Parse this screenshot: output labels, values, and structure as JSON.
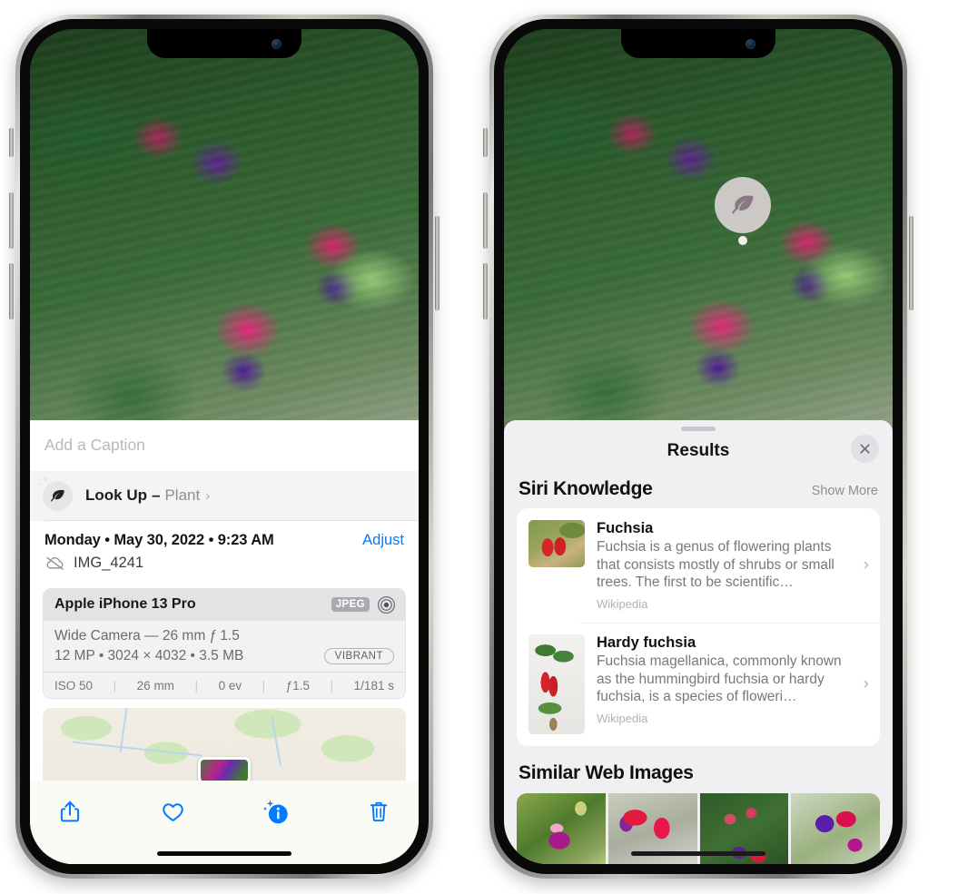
{
  "left_phone": {
    "photo": {
      "alt": "fuchsia-plant-photo",
      "name": "photo-fuchsia-hanging-basket"
    },
    "caption": {
      "placeholder": "Add a Caption",
      "value": ""
    },
    "look_up": {
      "icon": "leaf-icon",
      "label": "Look Up",
      "dash": "–",
      "subject": "Plant",
      "chevron": "›"
    },
    "meta": {
      "date": "Monday • May 30, 2022 • 9:23 AM",
      "adjust_label": "Adjust",
      "cloud_icon": "cloud-slash-icon",
      "filename": "IMG_4241"
    },
    "exif": {
      "device": "Apple iPhone 13 Pro",
      "format_chip": "JPEG",
      "aperture_icon": "aperture-icon",
      "lens_line": "Wide Camera — 26 mm ƒ 1.5",
      "dims_line": "12 MP • 3024 × 4032 • 3.5 MB",
      "style_chip": "VIBRANT",
      "stats": [
        "ISO 50",
        "26 mm",
        "0 ev",
        "ƒ1.5",
        "1/181 s"
      ],
      "separator": "|"
    },
    "map": {
      "name": "location-map-thumbnail",
      "pin": "photo-location-pin"
    },
    "toolbar": [
      {
        "name": "share-button",
        "icon": "share-icon"
      },
      {
        "name": "favorite-button",
        "icon": "heart-icon"
      },
      {
        "name": "info-button",
        "icon": "info-sparkle-icon"
      },
      {
        "name": "delete-button",
        "icon": "trash-icon"
      }
    ],
    "accent_color": "#047aff",
    "home_indicator": "home-indicator"
  },
  "right_phone": {
    "photo": {
      "alt": "fuchsia-plant-photo",
      "name": "photo-fuchsia-hanging-basket"
    },
    "visual_look_up_pin": {
      "icon": "leaf-icon",
      "name": "visual-look-up-pin"
    },
    "sheet": {
      "grabber": "sheet-grabber",
      "title": "Results",
      "close_icon": "close-icon",
      "sections": [
        {
          "title": "Siri Knowledge",
          "action": "Show More",
          "items": [
            {
              "title": "Fuchsia",
              "description": "Fuchsia is a genus of flowering plants that consists mostly of shrubs or small trees. The first to be scientific…",
              "source": "Wikipedia",
              "thumbnail": "fuchsia-red-flowers-thumb",
              "chevron": "›"
            },
            {
              "title": "Hardy fuchsia",
              "description": "Fuchsia magellanica, commonly known as the hummingbird fuchsia or hardy fuchsia, is a species of floweri…",
              "source": "Wikipedia",
              "thumbnail": "hardy-fuchsia-branch-thumb",
              "chevron": "›"
            }
          ]
        },
        {
          "title": "Similar Web Images",
          "images": [
            {
              "name": "web-image-1",
              "alt": "magenta-fuchsia-with-leaves"
            },
            {
              "name": "web-image-2",
              "alt": "red-fuchsia-closeup"
            },
            {
              "name": "web-image-3",
              "alt": "fuchsia-bush-buds"
            },
            {
              "name": "web-image-4",
              "alt": "purple-pink-fuchsia-cluster"
            }
          ]
        }
      ]
    },
    "home_indicator": "home-indicator"
  }
}
